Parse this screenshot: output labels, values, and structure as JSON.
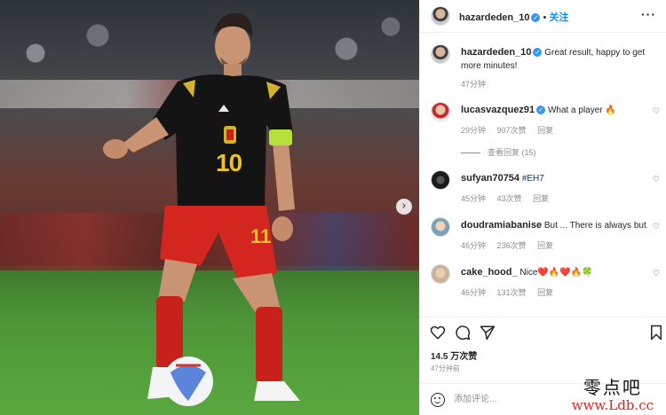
{
  "post": {
    "username": "hazardeden_10",
    "follow_label": "关注",
    "caption": "Great result, happy to get more minutes!",
    "caption_time": "47分钟",
    "likes": "14.5 万次赞",
    "time": "47分钟前",
    "comment_placeholder": "添加评论..."
  },
  "comments": [
    {
      "username": "lucasvazquez91",
      "verified": true,
      "text": "What a player 🔥",
      "time": "29分钟",
      "likes": "907次赞",
      "reply": "回复",
      "view_replies": "查看回复 (15)"
    },
    {
      "username": "sufyan70754",
      "verified": false,
      "text": "#EH7",
      "time": "45分钟",
      "likes": "43次赞",
      "reply": "回复"
    },
    {
      "username": "doudramiabanise",
      "verified": false,
      "text": "But ... There is always but...",
      "time": "46分钟",
      "likes": "236次赞",
      "reply": "回复"
    },
    {
      "username": "cake_hood_",
      "verified": false,
      "text": "Nice❤️🔥❤️🔥🍀",
      "time": "46分钟",
      "likes": "131次赞",
      "reply": "回复"
    }
  ],
  "photo": {
    "jersey_number": "10",
    "shorts_number": "11"
  },
  "icons": {
    "like": "heart-icon",
    "comment": "comment-icon",
    "share": "share-icon",
    "save": "bookmark-icon",
    "more": "more-options-icon",
    "next": "chevron-right-icon",
    "emoji": "emoji-icon"
  },
  "watermark": {
    "cn": "零点吧",
    "url": "www.Ldb.cc"
  },
  "colors": {
    "link": "#0095f6",
    "verified": "#3897f0",
    "muted": "#8e8e8e",
    "hashtag": "#00376b"
  }
}
